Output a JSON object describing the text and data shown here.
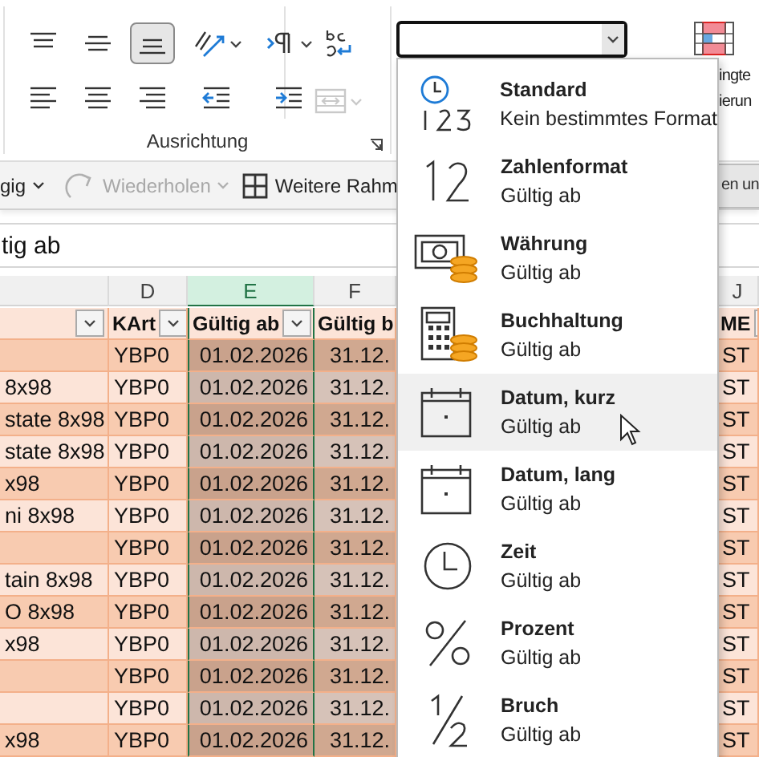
{
  "ribbon": {
    "alignment_buttons": [
      {
        "kind": "align-top",
        "selected": false
      },
      {
        "kind": "align-middle",
        "selected": false
      },
      {
        "kind": "align-bottom",
        "selected": true
      },
      {
        "kind": "orientation",
        "selected": false
      },
      {
        "kind": "text-direction",
        "selected": false
      },
      {
        "kind": "align-left",
        "selected": false
      },
      {
        "kind": "align-center",
        "selected": false
      },
      {
        "kind": "align-right",
        "selected": false
      },
      {
        "kind": "indent-decrease",
        "selected": false
      },
      {
        "kind": "indent-increase",
        "selected": false
      }
    ],
    "wrap_text": {
      "disabled": false
    },
    "merge": {
      "disabled": true
    },
    "group_label": "Ausrichtung",
    "side_label_lines": [
      "ingte",
      "ierun"
    ]
  },
  "quick_bar": [
    {
      "kind": "dropdown",
      "label": "gig",
      "disabled": false
    },
    {
      "kind": "redo",
      "label": "Wiederholen",
      "disabled": true
    },
    {
      "kind": "borders",
      "label": "Weitere Rahm",
      "disabled": false
    },
    {
      "kind": "boxed",
      "label": "en un",
      "disabled": false
    }
  ],
  "formula_bar": {
    "value": "tig ab"
  },
  "sheet": {
    "column_headers": [
      {
        "label": "D",
        "selected": false
      },
      {
        "label": "E",
        "selected": true
      },
      {
        "label": "F",
        "selected": false
      },
      {
        "label": "J",
        "selected": false
      }
    ],
    "header_row": [
      {
        "label": "KArt"
      },
      {
        "label": "Gültig ab"
      },
      {
        "label": "Gültig b"
      },
      {
        "label": "ME"
      }
    ],
    "rows": [
      {
        "kart": "YBP0",
        "valid_from": "01.02.2026",
        "valid_to": "31.12.",
        "unit": "ST"
      },
      {
        "name": "8x98",
        "kart": "YBP0",
        "valid_from": "01.02.2026",
        "valid_to": "31.12.",
        "unit": "ST"
      },
      {
        "name": "state 8x98",
        "kart": "YBP0",
        "valid_from": "01.02.2026",
        "valid_to": "31.12.",
        "unit": "ST"
      },
      {
        "name": "state 8x98",
        "kart": "YBP0",
        "valid_from": "01.02.2026",
        "valid_to": "31.12.",
        "unit": "ST"
      },
      {
        "name": "x98",
        "kart": "YBP0",
        "valid_from": "01.02.2026",
        "valid_to": "31.12.",
        "unit": "ST"
      },
      {
        "name": "ni 8x98",
        "kart": "YBP0",
        "valid_from": "01.02.2026",
        "valid_to": "31.12.",
        "unit": "ST"
      },
      {
        "kart": "YBP0",
        "valid_from": "01.02.2026",
        "valid_to": "31.12.",
        "unit": "ST"
      },
      {
        "name": "tain 8x98",
        "kart": "YBP0",
        "valid_from": "01.02.2026",
        "valid_to": "31.12.",
        "unit": "ST"
      },
      {
        "name": "O 8x98",
        "kart": "YBP0",
        "valid_from": "01.02.2026",
        "valid_to": "31.12.",
        "unit": "ST"
      },
      {
        "name": "x98",
        "kart": "YBP0",
        "valid_from": "01.02.2026",
        "valid_to": "31.12.",
        "unit": "ST"
      },
      {
        "kart": "YBP0",
        "valid_from": "01.02.2026",
        "valid_to": "31.12.",
        "unit": "ST"
      },
      {
        "kart": "YBP0",
        "valid_from": "01.02.2026",
        "valid_to": "31.12.",
        "unit": "ST"
      },
      {
        "name": "x98",
        "kart": "YBP0",
        "valid_from": "01.02.2026",
        "valid_to": "31.12.",
        "unit": "ST"
      }
    ]
  },
  "format_menu": [
    {
      "kind": "general",
      "title": "Standard",
      "example": "Kein bestimmtes Format",
      "highlighted": false
    },
    {
      "kind": "number",
      "title": "Zahlenformat",
      "example": "Gültig ab",
      "highlighted": false
    },
    {
      "kind": "currency",
      "title": "Währung",
      "example": "Gültig ab",
      "highlighted": false
    },
    {
      "kind": "accounting",
      "title": "Buchhaltung",
      "example": "Gültig ab",
      "highlighted": false
    },
    {
      "kind": "date-short",
      "title": "Datum, kurz",
      "example": "Gültig ab",
      "highlighted": true
    },
    {
      "kind": "date-long",
      "title": "Datum, lang",
      "example": "Gültig ab",
      "highlighted": false
    },
    {
      "kind": "time",
      "title": "Zeit",
      "example": "Gültig ab",
      "highlighted": false
    },
    {
      "kind": "percent",
      "title": "Prozent",
      "example": "Gültig ab",
      "highlighted": false
    },
    {
      "kind": "fraction",
      "title": "Bruch",
      "example": "Gültig ab",
      "highlighted": false
    }
  ]
}
